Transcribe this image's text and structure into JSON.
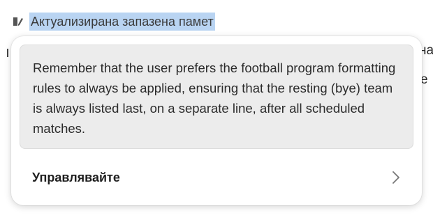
{
  "header": {
    "title": "Актуализирана запазена памет",
    "icon": "memory-pen-icon"
  },
  "background_fragments": [
    "на",
    "е"
  ],
  "popover": {
    "memory_text": "Remember that the user prefers the football program formatting rules to always be applied, ensuring that the resting (bye) team is always listed last, on a separate line, after all scheduled matches.",
    "manage_label": "Управлявайте",
    "manage_icon": "chevron-right-icon"
  },
  "colors": {
    "highlight": "#b9d4f2",
    "card_bg": "#ececec"
  }
}
